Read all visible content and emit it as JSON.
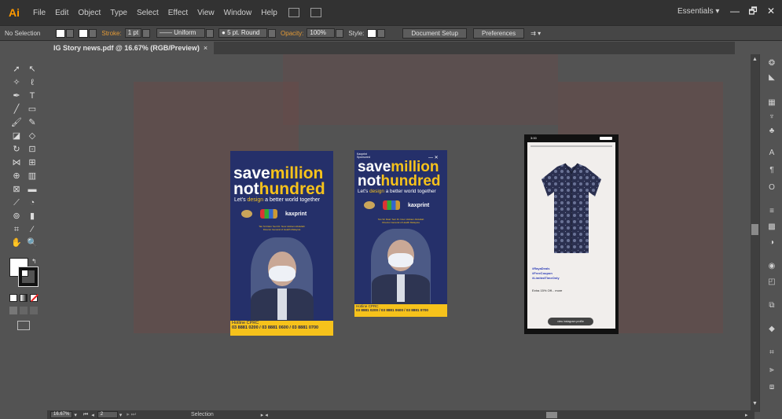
{
  "app": {
    "logo": "Ai",
    "menus": [
      "File",
      "Edit",
      "Object",
      "Type",
      "Select",
      "Effect",
      "View",
      "Window",
      "Help"
    ],
    "workspace": "Essentials",
    "win_min": "—",
    "win_max": "🗗",
    "win_close": "✕"
  },
  "control": {
    "selection": "No Selection",
    "stroke_label": "Stroke:",
    "stroke_weight": "1 pt",
    "profile": "Uniform",
    "brush": "5 pt. Round",
    "opacity_label": "Opacity:",
    "opacity_value": "100%",
    "style_label": "Style:",
    "document_setup": "Document Setup",
    "preferences": "Preferences"
  },
  "document": {
    "tab_title": "IG Story news.pdf @ 16.67% (RGB/Preview)",
    "tab_close": "×"
  },
  "artboards": {
    "headline_1": "save",
    "headline_1b": "million",
    "headline_2": "not",
    "headline_2b": "hundred",
    "subline_1": "Let's ",
    "subline_2": "design",
    "subline_3": " a better world together",
    "kaxprint": "kaxprint",
    "caption": "Tan Sri Dato' Seri Dr. Noor Hisham Abdullah",
    "caption_2": "Director General of Health Malaysia",
    "hotline_label": "Hotline CPRC",
    "hotline_numbers": "03 8881 0200 / 03 8881 0600 / 03 8881 0700",
    "sponsor_1": "Kaxprint",
    "sponsor_2": "Sponsored",
    "story_close": "— ✕"
  },
  "phone": {
    "time": "3:00",
    "tags": [
      "#RayaDeals",
      "#FreeCoupon",
      "#LimitedTimeOnly"
    ],
    "offer": "Extra 15% Off... more",
    "cta": "view instagram profile"
  },
  "status": {
    "zoom": "16.67%",
    "page": "2",
    "tool": "Selection"
  },
  "colors": {
    "brand_blue": "#25306a",
    "brand_yellow": "#f6c21b",
    "app_bg": "#535353"
  }
}
